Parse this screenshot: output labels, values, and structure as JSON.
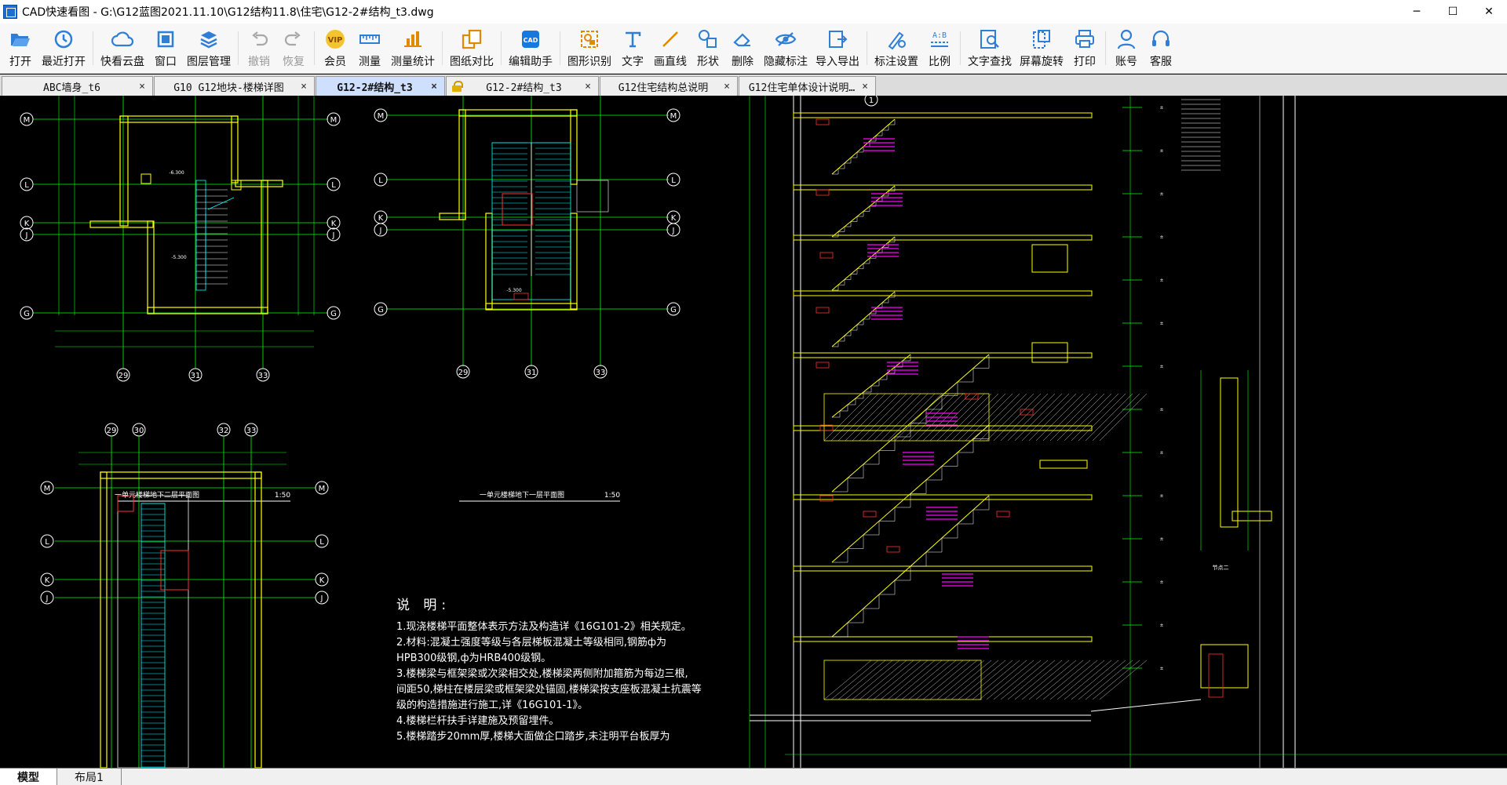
{
  "window": {
    "title": "CAD快速看图 - G:\\G12蓝图2021.11.10\\G12结构11.8\\住宅\\G12-2#结构_t3.dwg",
    "minimize": "─",
    "maximize": "☐",
    "close": "✕"
  },
  "toolbar": {
    "items": [
      {
        "label": "打开",
        "icon": "folder-open-icon"
      },
      {
        "label": "最近打开",
        "icon": "clock-icon"
      },
      {
        "label": "快看云盘",
        "icon": "cloud-icon"
      },
      {
        "label": "窗口",
        "icon": "window-icon"
      },
      {
        "label": "图层管理",
        "icon": "layers-icon"
      },
      {
        "label": "撤销",
        "icon": "undo-icon"
      },
      {
        "label": "恢复",
        "icon": "redo-icon"
      },
      {
        "label": "会员",
        "icon": "vip-icon"
      },
      {
        "label": "测量",
        "icon": "ruler-icon"
      },
      {
        "label": "测量统计",
        "icon": "measure-stats-icon"
      },
      {
        "label": "图纸对比",
        "icon": "compare-icon"
      },
      {
        "label": "编辑助手",
        "icon": "edit-assistant-icon"
      },
      {
        "label": "图形识别",
        "icon": "shape-recognize-icon"
      },
      {
        "label": "文字",
        "icon": "text-icon"
      },
      {
        "label": "画直线",
        "icon": "line-icon"
      },
      {
        "label": "形状",
        "icon": "shape-icon"
      },
      {
        "label": "删除",
        "icon": "eraser-icon"
      },
      {
        "label": "隐藏标注",
        "icon": "eye-hide-icon"
      },
      {
        "label": "导入导出",
        "icon": "import-export-icon"
      },
      {
        "label": "标注设置",
        "icon": "annotation-settings-icon"
      },
      {
        "label": "比例",
        "icon": "scale-icon"
      },
      {
        "label": "文字查找",
        "icon": "text-search-icon"
      },
      {
        "label": "屏幕旋转",
        "icon": "rotate-screen-icon"
      },
      {
        "label": "打印",
        "icon": "print-icon"
      },
      {
        "label": "账号",
        "icon": "user-icon"
      },
      {
        "label": "客服",
        "icon": "headset-icon"
      }
    ]
  },
  "tabs": [
    {
      "label": "ABC墙身_t6",
      "close": "×"
    },
    {
      "label": "G10 G12地块-楼梯详图",
      "close": "×"
    },
    {
      "label": "G12-2#结构_t3",
      "close": "×",
      "active": true
    },
    {
      "label": "G12-2#结构_t3",
      "close": "×",
      "locked": true
    },
    {
      "label": "G12住宅结构总说明",
      "close": "×"
    },
    {
      "label": "G12住宅单体设计说明…",
      "close": "×"
    }
  ],
  "drawing": {
    "axis_labels_plan1": [
      "M",
      "L",
      "K",
      "J",
      "G"
    ],
    "axis_cols_plan1": [
      "29",
      "31",
      "33"
    ],
    "axis_labels_plan2": [
      "M",
      "L",
      "K",
      "J",
      "G"
    ],
    "axis_cols_plan2": [
      "29",
      "31",
      "33"
    ],
    "axis_cols_plan3": [
      "29",
      "30",
      "32",
      "33"
    ],
    "axis_labels_plan3": [
      "M",
      "L",
      "K",
      "J"
    ],
    "plan1_caption": "一单元楼梯地下二层平面图",
    "plan1_scale": "1:50",
    "plan2_caption": "一单元楼梯地下一层平面图",
    "plan2_scale": "1:50",
    "notes_title": "说 明:",
    "notes": [
      "1.现浇楼梯平面整体表示方法及构造详《16G101-2》相关规定。",
      "2.材料:混凝土强度等级与各层梯板混凝土等级相同,钢筋ф为",
      "  HPB300级钢,ф为HRB400级钢。",
      "3.楼梯梁与框架梁或次梁相交处,楼梯梁两侧附加箍筋为每边三根,",
      "  间距50,梯柱在楼层梁或框架梁处锚固,楼梯梁按支座板混凝土抗震等",
      "  级的构造措施进行施工,详《16G101-1》。",
      "4.楼梯栏杆扶手详建施及预留埋件。",
      "5.楼梯踏步20mm厚,楼梯大面做企口踏步,未注明平台板厚为"
    ]
  },
  "layout_tabs": [
    {
      "label": "模型",
      "active": true
    },
    {
      "label": "布局1"
    }
  ]
}
